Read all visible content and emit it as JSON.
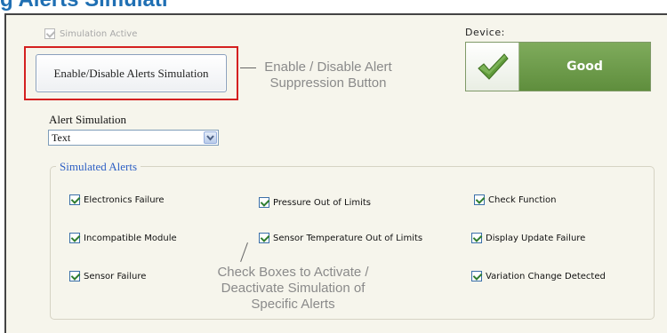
{
  "page_heading": "g Alerts Simulati",
  "simulation_active": {
    "label": "Simulation Active",
    "checked": true,
    "disabled": true
  },
  "alerts_button": {
    "label": "Enable/Disable Alerts Simulation"
  },
  "callout_button": {
    "line1": "Enable / Disable Alert",
    "line2": "Suppression Button"
  },
  "device": {
    "label": "Device:",
    "status": "Good",
    "status_color": "#6b9a48",
    "icon": "check-mark-icon"
  },
  "alert_simulation": {
    "label": "Alert Simulation",
    "selected": "Text"
  },
  "simulated_alerts": {
    "legend": "Simulated Alerts",
    "items": [
      {
        "label": "Electronics Failure",
        "checked": true
      },
      {
        "label": "Pressure Out of Limits",
        "checked": true
      },
      {
        "label": "Check Function",
        "checked": true
      },
      {
        "label": "Incompatible Module",
        "checked": true
      },
      {
        "label": "Sensor Temperature Out of Limits",
        "checked": true
      },
      {
        "label": "Display Update Failure",
        "checked": true
      },
      {
        "label": "Sensor Failure",
        "checked": true
      },
      {
        "label": "Variation Change Detected",
        "checked": true
      }
    ]
  },
  "callout_checkboxes": {
    "line1": "Check Boxes to  Activate /",
    "line2": "Deactivate Simulation of",
    "line3": "Specific Alerts"
  },
  "colors": {
    "accent_blue": "#1f6fb3",
    "highlight_red": "#d42020",
    "panel_bg": "#f6f5ec"
  }
}
